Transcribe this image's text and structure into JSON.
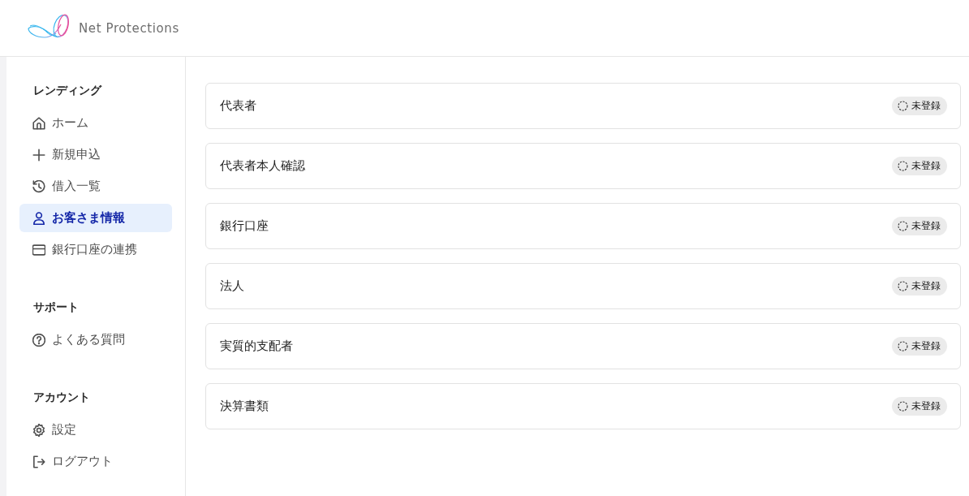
{
  "header": {
    "brand": "Net Protections"
  },
  "sidebar": {
    "sections": [
      {
        "heading": "レンディング",
        "items": [
          {
            "label": "ホーム",
            "kind": "home",
            "selected": false
          },
          {
            "label": "新規申込",
            "kind": "plus",
            "selected": false
          },
          {
            "label": "借入一覧",
            "kind": "history",
            "selected": false
          },
          {
            "label": "お客さま情報",
            "kind": "user",
            "selected": true
          },
          {
            "label": "銀行口座の連携",
            "kind": "card",
            "selected": false
          }
        ]
      },
      {
        "heading": "サポート",
        "items": [
          {
            "label": "よくある質問",
            "kind": "help",
            "selected": false
          }
        ]
      },
      {
        "heading": "アカウント",
        "items": [
          {
            "label": "設定",
            "kind": "settings",
            "selected": false
          },
          {
            "label": "ログアウト",
            "kind": "logout",
            "selected": false
          }
        ]
      }
    ]
  },
  "cards": [
    {
      "title": "代表者",
      "status": "未登録"
    },
    {
      "title": "代表者本人確認",
      "status": "未登録"
    },
    {
      "title": "銀行口座",
      "status": "未登録"
    },
    {
      "title": "法人",
      "status": "未登録"
    },
    {
      "title": "実質的支配者",
      "status": "未登録"
    },
    {
      "title": "決算書類",
      "status": "未登録"
    }
  ]
}
